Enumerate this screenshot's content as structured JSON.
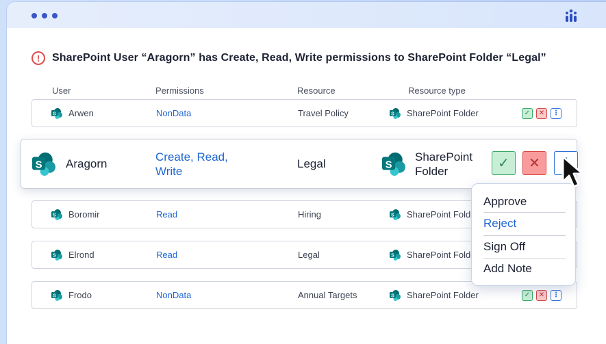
{
  "alert": {
    "text": "SharePoint User “Aragorn” has Create, Read, Write permissions to SharePoint Folder “Legal”",
    "icon": "!"
  },
  "headers": {
    "user": "User",
    "permissions": "Permissions",
    "resource": "Resource",
    "resource_type": "Resource type"
  },
  "rows": [
    {
      "user": "Arwen",
      "permissions": "NonData",
      "resource": "Travel Policy",
      "resource_type": "SharePoint Folder"
    },
    {
      "user": "Aragorn",
      "permissions_line1": "Create, Read,",
      "permissions_line2": "Write",
      "resource": "Legal",
      "resource_type_line1": "SharePoint",
      "resource_type_line2": "Folder"
    },
    {
      "user": "Boromir",
      "permissions": "Read",
      "resource": "Hiring",
      "resource_type": "SharePoint Folde"
    },
    {
      "user": "Elrond",
      "permissions": "Read",
      "resource": "Legal",
      "resource_type": "SharePoint Folde"
    },
    {
      "user": "Frodo",
      "permissions": "NonData",
      "resource": "Annual Targets",
      "resource_type": "SharePoint Folder"
    }
  ],
  "buttons": {
    "approve": "✓",
    "reject": "✕",
    "more": "⋮"
  },
  "menu": {
    "approve": "Approve",
    "reject": "Reject",
    "sign_off": "Sign Off",
    "add_note": "Add Note"
  },
  "colors": {
    "accent": "#1f66d1",
    "approve_green": "#36a867",
    "reject_red": "#d64545",
    "sharepoint_teal": "#0b7a7f"
  }
}
